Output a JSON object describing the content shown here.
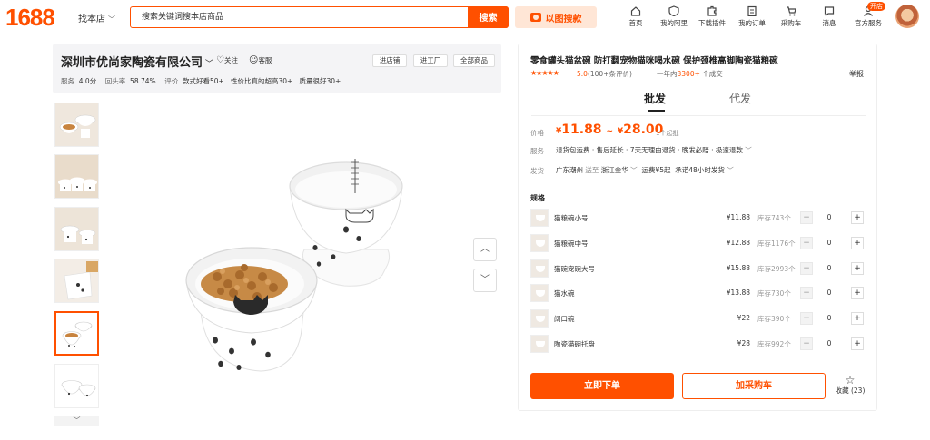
{
  "header": {
    "logo": "1688",
    "store_switch": "找本店",
    "search_placeholder": "搜索关键词搜本店商品",
    "search_button": "搜索",
    "image_search": "以图搜款",
    "nav": [
      {
        "label": "首页",
        "icon": "home-icon"
      },
      {
        "label": "我的阿里",
        "icon": "heart-shield-icon"
      },
      {
        "label": "下载插件",
        "icon": "puzzle-icon"
      },
      {
        "label": "我的订单",
        "icon": "clipboard-icon"
      },
      {
        "label": "采购车",
        "icon": "cart-icon"
      },
      {
        "label": "消息",
        "icon": "message-icon"
      },
      {
        "label": "官方服务",
        "icon": "user-icon"
      }
    ],
    "open_badge": "开店"
  },
  "store": {
    "name": "深圳市优尚家陶瓷有限公司",
    "follow": "关注",
    "service": "客服",
    "buttons": [
      "进店铺",
      "进工厂",
      "全部商品"
    ],
    "stats": [
      {
        "label": "服务",
        "value": "4.0分"
      },
      {
        "label": "回头率",
        "value": "58.74%"
      },
      {
        "label": "评价",
        "value": "款式好看50+"
      },
      {
        "label": "",
        "value": "性价比真的超高30+"
      },
      {
        "label": "",
        "value": "质量很好30+"
      }
    ]
  },
  "product": {
    "title": "零食罐头猫盆碗 防打翻宠物猫咪喝水碗 保护颈椎高脚陶瓷猫粮碗",
    "stars": "★★★★★",
    "rating": "5.0",
    "reviews": "100+条评价",
    "sales_prefix": "一年内",
    "sales_count": "3300+",
    "sales_suffix": "个成交",
    "report": "举报",
    "tabs": [
      "批发",
      "代发"
    ],
    "price_label": "价格",
    "price_min": "11.88",
    "price_max": "28.00",
    "currency": "¥",
    "moq": "1个起批",
    "service_label": "服务",
    "service_text": "退货包运费 · 售后延长 · 7天无理由退货 · 晚发必赔 · 极速退款",
    "ship_label": "发货",
    "ship_from": "广东潮州",
    "ship_to_word": "送至",
    "ship_to": "浙江金华",
    "freight": "运费¥5起",
    "ship_promise": "承诺48小时发货",
    "spec_title": "规格",
    "skus": [
      {
        "name": "猫粮碗小号",
        "price": "¥11.88",
        "stock": "库存743个",
        "qty": "0"
      },
      {
        "name": "猫粮碗中号",
        "price": "¥12.88",
        "stock": "库存1176个",
        "qty": "0"
      },
      {
        "name": "猫碗宠碗大号",
        "price": "¥15.88",
        "stock": "库存2993个",
        "qty": "0"
      },
      {
        "name": "猫水碗",
        "price": "¥13.88",
        "stock": "库存730个",
        "qty": "0"
      },
      {
        "name": "阔口碗",
        "price": "¥22",
        "stock": "库存390个",
        "qty": "0"
      },
      {
        "name": "陶瓷猫碗托盘",
        "price": "¥28",
        "stock": "库存992个",
        "qty": "0"
      }
    ],
    "buy_now": "立即下单",
    "add_cart": "加采购车",
    "favorite": "收藏",
    "favorite_count": "(23)"
  }
}
